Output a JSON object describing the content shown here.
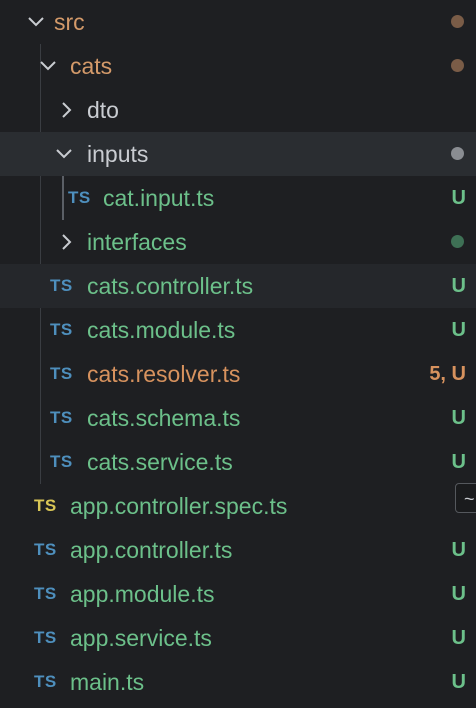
{
  "colors": {
    "folder_modified": "#d49a6a",
    "folder_plain": "#c9ccd1",
    "untracked": "#6cc08a",
    "error_orange": "#d7925e",
    "ts_blue": "#4e8fbd",
    "ts_yellow": "#d9c656",
    "dot_brown": "#7a5c47",
    "dot_grey": "#8a8d92",
    "dot_green": "#3e7055"
  },
  "tree": {
    "src": {
      "label": "src",
      "icon": "chevron-down"
    },
    "cats": {
      "label": "cats",
      "icon": "chevron-down"
    },
    "dto": {
      "label": "dto",
      "icon": "chevron-right"
    },
    "inputs": {
      "label": "inputs",
      "icon": "chevron-down"
    },
    "cat_input": {
      "icon": "TS",
      "label": "cat.input.ts",
      "badge": "U"
    },
    "interfaces": {
      "label": "interfaces",
      "icon": "chevron-right"
    },
    "cats_controller": {
      "icon": "TS",
      "label": "cats.controller.ts",
      "badge": "U"
    },
    "cats_module": {
      "icon": "TS",
      "label": "cats.module.ts",
      "badge": "U"
    },
    "cats_resolver": {
      "icon": "TS",
      "label": "cats.resolver.ts",
      "badge": "5, U"
    },
    "cats_schema": {
      "icon": "TS",
      "label": "cats.schema.ts",
      "badge": "U"
    },
    "cats_service": {
      "icon": "TS",
      "label": "cats.service.ts",
      "badge": "U"
    },
    "app_controller_spec": {
      "icon": "TS",
      "label": "app.controller.spec.ts",
      "badge": ""
    },
    "app_controller": {
      "icon": "TS",
      "label": "app.controller.ts",
      "badge": "U"
    },
    "app_module": {
      "icon": "TS",
      "label": "app.module.ts",
      "badge": "U"
    },
    "app_service": {
      "icon": "TS",
      "label": "app.service.ts",
      "badge": "U"
    },
    "main": {
      "icon": "TS",
      "label": "main.ts",
      "badge": "U"
    }
  },
  "tooltip": {
    "text": "~"
  }
}
